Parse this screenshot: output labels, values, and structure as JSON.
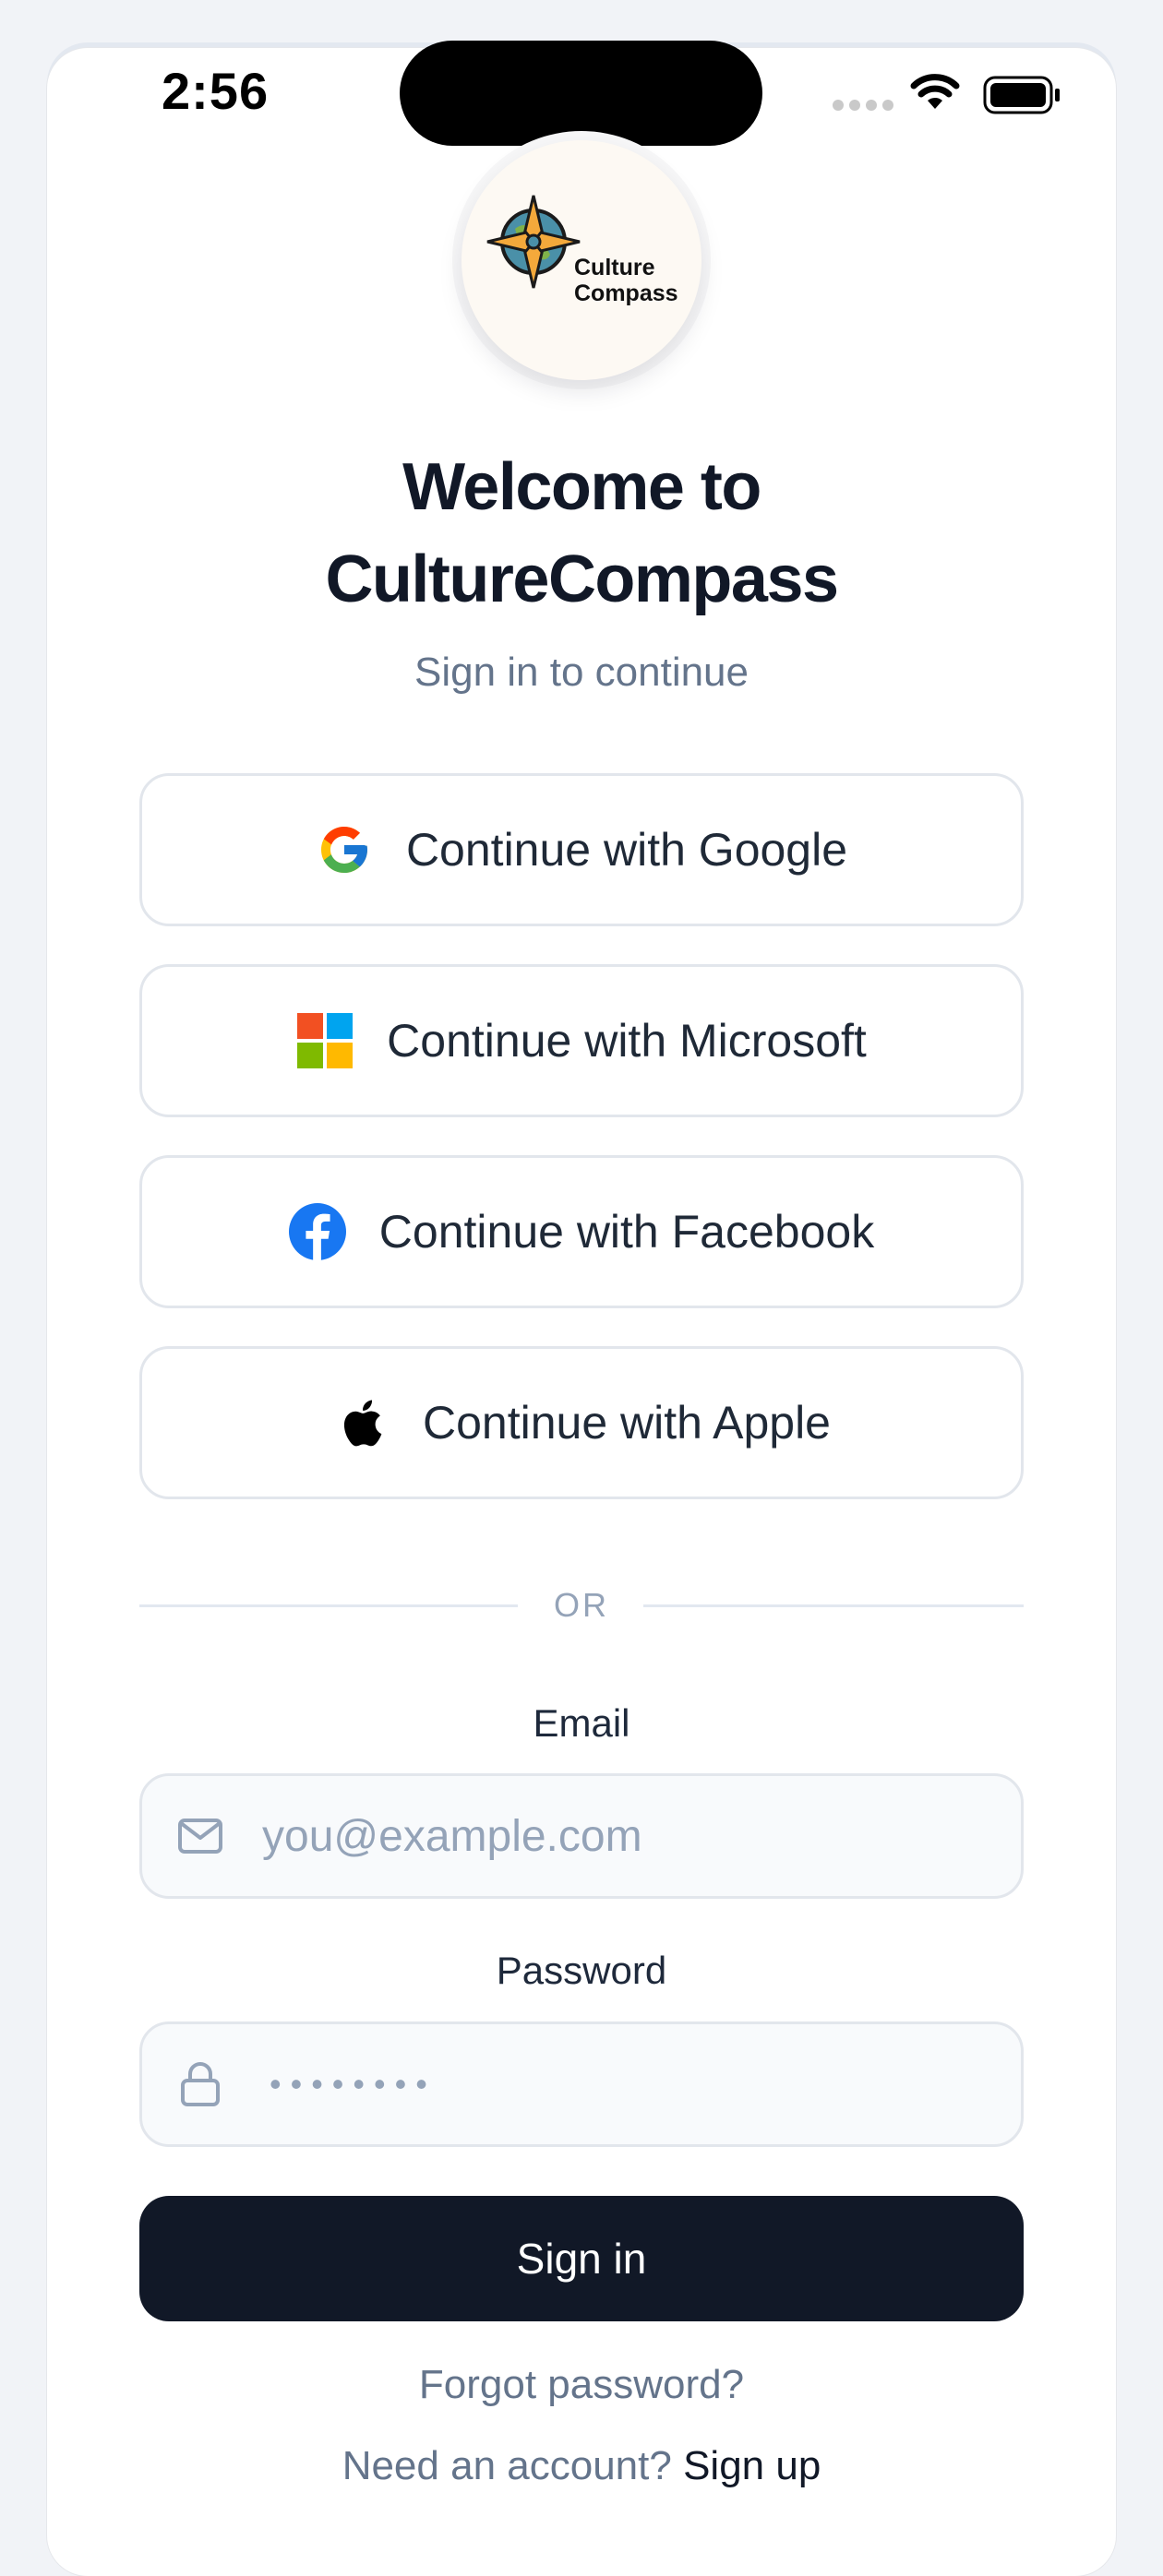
{
  "status_bar": {
    "time": "2:56"
  },
  "logo": {
    "line1": "Culture",
    "line2": "Compass"
  },
  "header": {
    "title_line1": "Welcome to",
    "title_line2": "CultureCompass",
    "subtitle": "Sign in to continue"
  },
  "oauth": {
    "google": "Continue with Google",
    "microsoft": "Continue with Microsoft",
    "facebook": "Continue with Facebook",
    "apple": "Continue with Apple"
  },
  "divider": {
    "text": "OR"
  },
  "form": {
    "email_label": "Email",
    "email_placeholder": "you@example.com",
    "password_label": "Password",
    "password_masked": "••••••••",
    "submit_label": "Sign in"
  },
  "footer": {
    "forgot": "Forgot password?",
    "need_account": "Need an account?",
    "signup": "Sign up"
  },
  "colors": {
    "primary": "#111827",
    "muted": "#64748b",
    "google_blue": "#4285F4",
    "facebook_blue": "#1877F2",
    "ms_red": "#F25022",
    "ms_green": "#7FBA00",
    "ms_blue": "#00A4EF",
    "ms_yellow": "#FFB900"
  },
  "icons": [
    "google-icon",
    "microsoft-icon",
    "facebook-icon",
    "apple-icon",
    "mail-icon",
    "lock-icon",
    "wifi-icon",
    "battery-icon",
    "compass-logo-icon"
  ]
}
